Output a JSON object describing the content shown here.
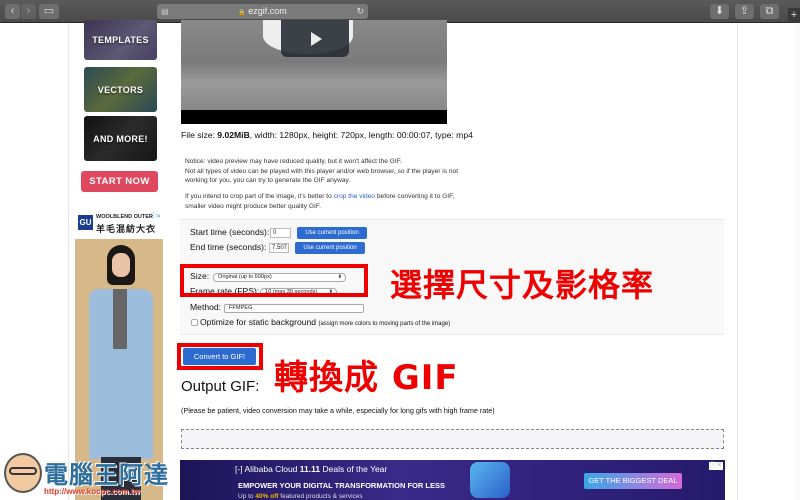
{
  "browser": {
    "url": "ezgif.com",
    "back_icon": "‹",
    "forward_icon": "›",
    "sidebar_icon": "▭",
    "reload_icon": "↻",
    "lock_icon": "🔒",
    "download_icon": "⬇",
    "share_icon": "⇪",
    "tabs_icon": "⧉",
    "new_tab_icon": "+"
  },
  "sidebar": {
    "promos": [
      {
        "label": "TEMPLATES"
      },
      {
        "label": "VECTORS"
      },
      {
        "label": "AND MORE!"
      }
    ],
    "start_now": "START NOW",
    "ad": {
      "brand": "GU",
      "line1": "WOOLBLEND OUTER",
      "line2": "羊毛混紡大衣",
      "choice": "ⓘ✕"
    }
  },
  "video": {
    "file_info_prefix": "File size: ",
    "file_size": "9.02MiB",
    "file_info_rest": ", width: 1280px, height: 720px, length: 00:00:07, type: mp4"
  },
  "notices": {
    "line1": "Notice: video preview may have reduced quality, but it won't affect the GIF.",
    "line2": "Not all types of video can be played with this player and/or web browser, so if the player is not working for you, you can try to generate the GIF anyway.",
    "crop_before": "If you intend to crop part of the image, it's better to ",
    "crop_link": "crop the video",
    "crop_after": " before converting it to GIF, smaller video might produce better quality GIF."
  },
  "form": {
    "start_label": "Start time (seconds):",
    "start_value": "0",
    "end_label": "End time (seconds):",
    "end_value": "7.507",
    "use_position": "Use current position",
    "size_label": "Size:",
    "size_value": "Original (up to 600px)",
    "fps_label": "Frame rate (FPS):",
    "fps_value": "10 (max 30 seconds)",
    "method_label": "Method:",
    "method_value": "FFMPEG",
    "optimize_label": "Optimize for static background",
    "optimize_note": "(assign more colors to moving parts of the image)",
    "optimize_checked": false,
    "convert_button": "Convert to GIF!"
  },
  "output": {
    "title": "Output GIF:",
    "patience": "(Please be patient, video conversion may take a while, especially for long gifs with high frame rate)"
  },
  "annotations": {
    "size_fps": "選擇尺寸及影格率",
    "convert": "轉換成 GIF"
  },
  "bottom_ad": {
    "brand": "Alibaba Cloud",
    "event": "11.11",
    "deal": "Deals of the Year",
    "headline": "EMPOWER YOUR DIGITAL TRANSFORMATION FOR LESS",
    "sub_prefix": "Up to ",
    "sub_highlight": "40% off",
    "sub_rest": " featured products & services",
    "cta": "GET THE BIGGEST DEAL",
    "choice": "ⓘ✕"
  },
  "watermark": {
    "title": "電腦王阿達",
    "url": "http://www.kocpc.com.tw"
  },
  "colors": {
    "accent_blue": "#2d6bd0",
    "start_now": "#e0485f",
    "annotation_red": "#ee0000"
  }
}
